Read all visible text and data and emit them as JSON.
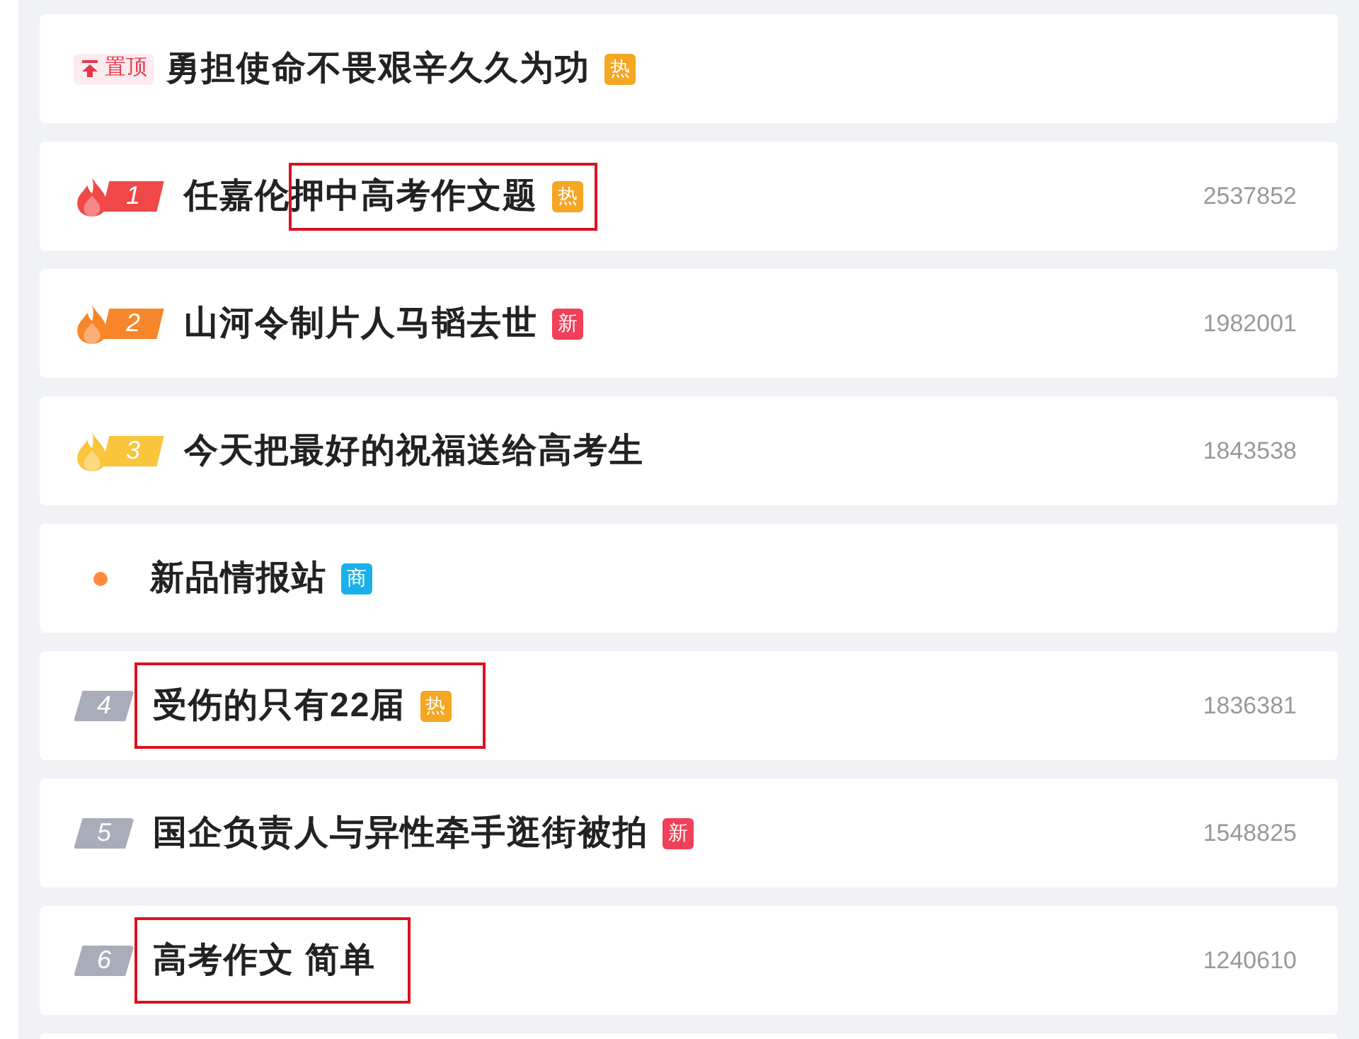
{
  "items": [
    {
      "kind": "pinned",
      "pin_label": "置顶",
      "title": "勇担使命不畏艰辛久久为功",
      "badge": {
        "text": "热",
        "color": "#f5a623"
      }
    },
    {
      "kind": "top",
      "rank": "1",
      "color": "#f04848",
      "title": "任嘉伦押中高考作文题",
      "badge": {
        "text": "热",
        "color": "#f5a623"
      },
      "count": "2537852",
      "framed": true,
      "frame_covers_start": false
    },
    {
      "kind": "top",
      "rank": "2",
      "color": "#f7862a",
      "title": "山河令制片人马韬去世",
      "badge": {
        "text": "新",
        "color": "#f0405a"
      },
      "count": "1982001"
    },
    {
      "kind": "top",
      "rank": "3",
      "color": "#f8c53c",
      "title": "今天把最好的祝福送给高考生",
      "count": "1843538"
    },
    {
      "kind": "ad",
      "color": "#ff8a3d",
      "title": "新品情报站",
      "badge": {
        "text": "商",
        "color": "#1ab1ea"
      }
    },
    {
      "kind": "rank",
      "rank": "4",
      "color": "#a9adba",
      "title": "受伤的只有22届",
      "badge": {
        "text": "热",
        "color": "#f5a623"
      },
      "count": "1836381",
      "framed": true,
      "frame_covers_start": true
    },
    {
      "kind": "rank",
      "rank": "5",
      "color": "#a9adba",
      "title": "国企负责人与异性牵手逛街被拍",
      "badge": {
        "text": "新",
        "color": "#f0405a"
      },
      "count": "1548825"
    },
    {
      "kind": "rank",
      "rank": "6",
      "color": "#a9adba",
      "title": "高考作文 简单",
      "count": "1240610",
      "framed": true,
      "frame_covers_start": true
    }
  ]
}
